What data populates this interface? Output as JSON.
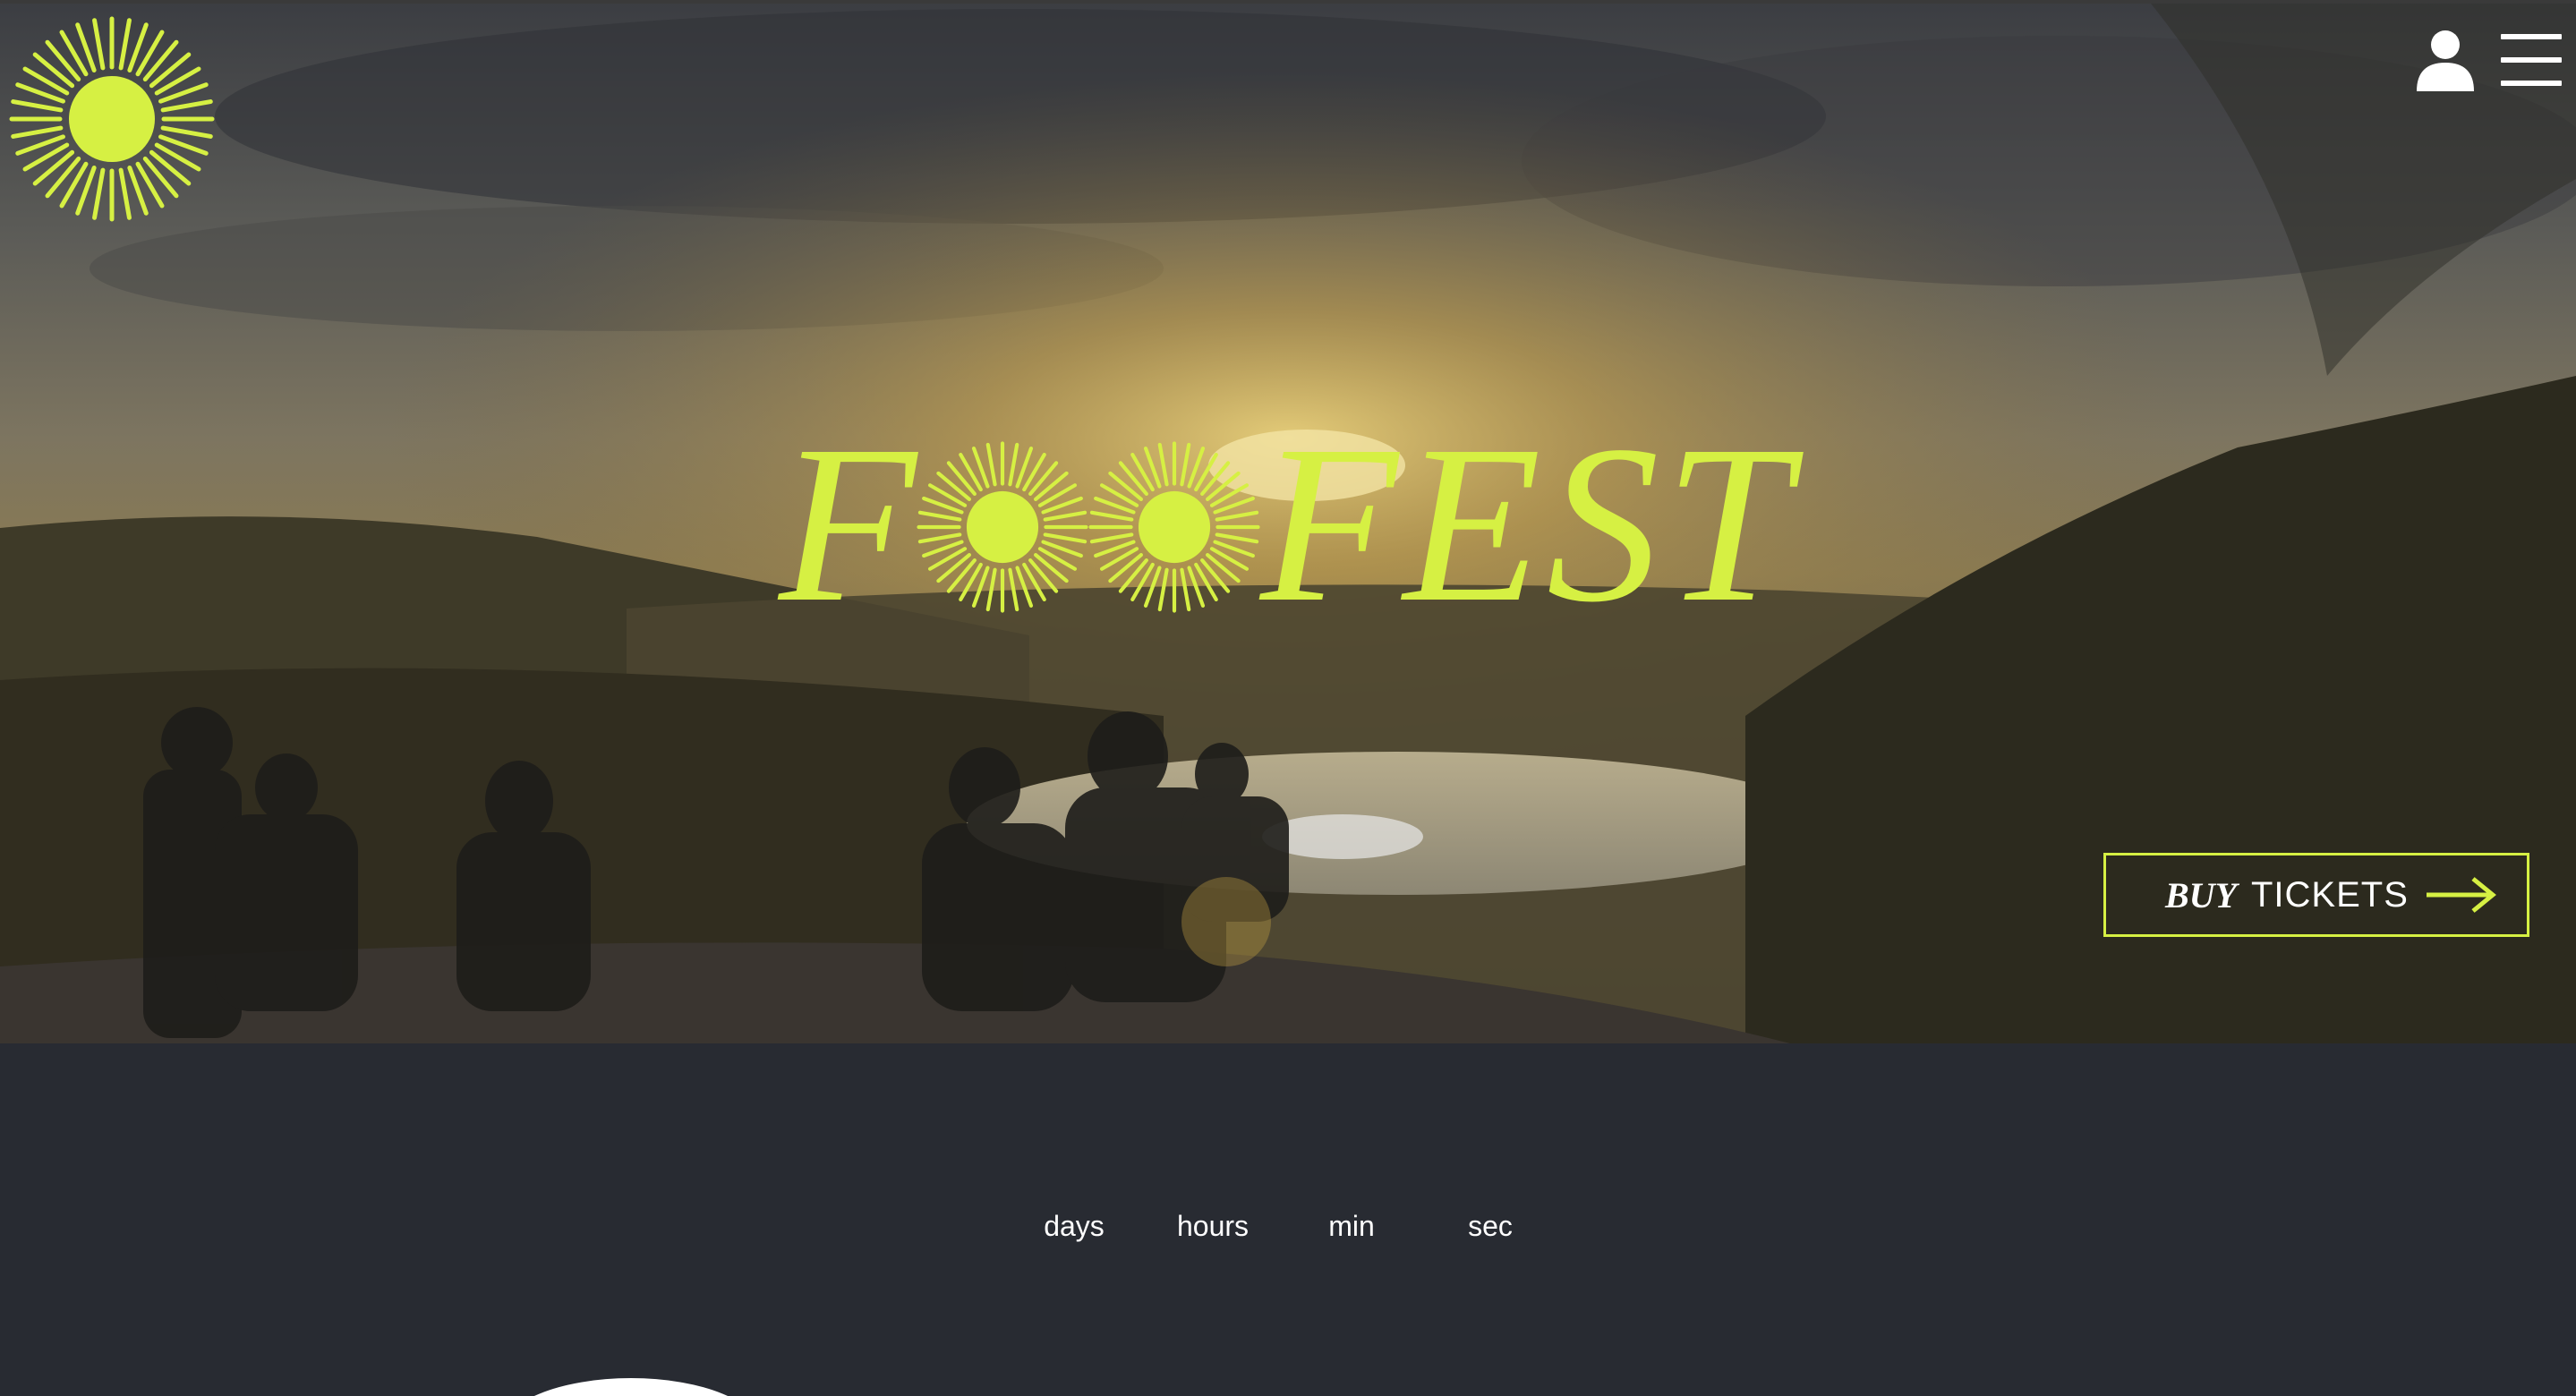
{
  "header": {
    "logo_icon": "sun-burst-icon",
    "account_icon": "user-icon",
    "menu_icon": "hamburger-menu-icon"
  },
  "hero": {
    "title_left": "F",
    "title_right": "FEST",
    "title_sun_icon": "sun-burst-icon",
    "cta": {
      "buy_label": "BUY",
      "tickets_label": "TICKETS",
      "arrow_icon": "arrow-right-icon"
    }
  },
  "countdown": {
    "days_label": "days",
    "hours_label": "hours",
    "min_label": "min",
    "sec_label": "sec"
  },
  "colors": {
    "accent": "#d6f043",
    "background_dark": "#282b32",
    "text_light": "#ffffff"
  }
}
